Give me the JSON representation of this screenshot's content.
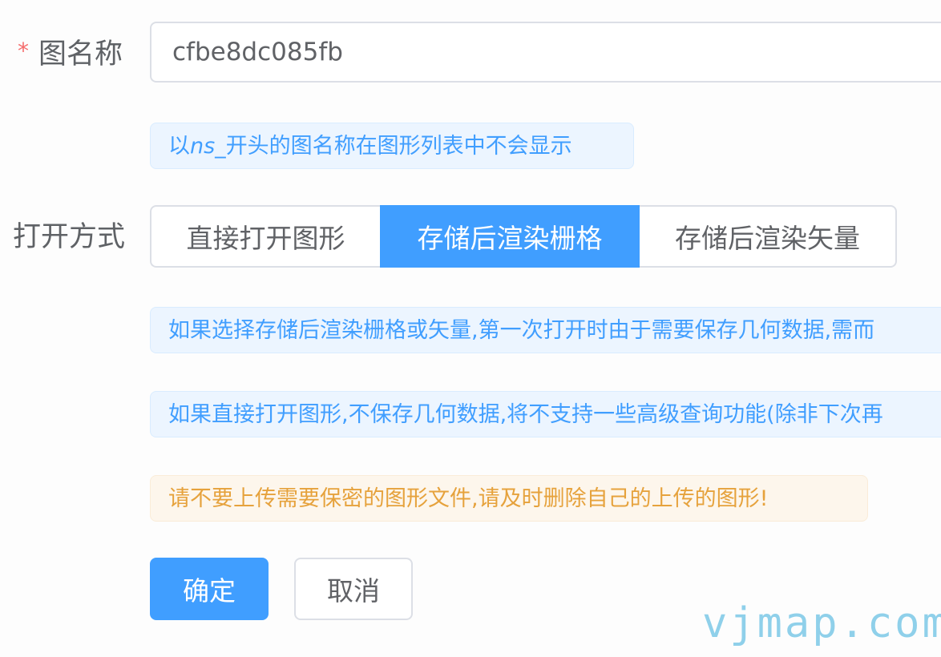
{
  "form": {
    "name_label": "图名称",
    "required_mark": "*",
    "name_value": "cfbe8dc085fb",
    "name_hint_prefix": "以",
    "name_hint_em": "ns_",
    "name_hint_suffix": "开头的图名称在图形列表中不会显示",
    "open_mode_label": "打开方式",
    "open_modes": [
      {
        "label": "直接打开图形",
        "selected": false
      },
      {
        "label": "存储后渲染栅格",
        "selected": true
      },
      {
        "label": "存储后渲染矢量",
        "selected": false
      }
    ],
    "info_notes": [
      "如果选择存储后渲染栅格或矢量,第一次打开时由于需要保存几何数据,需而",
      "如果直接打开图形,不保存几何数据,将不支持一些高级查询功能(除非下次再"
    ],
    "warning": "请不要上传需要保密的图形文件,请及时删除自己的上传的图形!",
    "confirm_label": "确定",
    "cancel_label": "取消"
  },
  "watermark": "vjmap.com",
  "colors": {
    "primary": "#409eff",
    "info_bg": "#ecf5ff",
    "warning_text": "#e6a23c",
    "warning_bg": "#fdf6ec",
    "required": "#f56c6c",
    "border": "#dcdfe6"
  }
}
